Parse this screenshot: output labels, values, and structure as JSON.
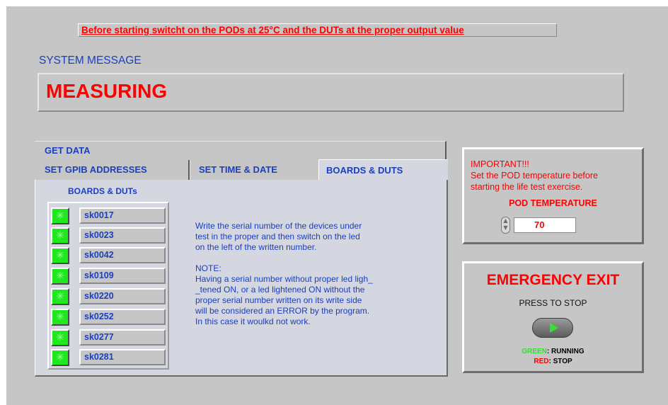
{
  "warning_banner": "Before starting switcht on the PODs at 25°C and the DUTs at the proper output value",
  "system_message": {
    "label": "SYSTEM MESSAGE",
    "value": "MEASURING"
  },
  "tabs": {
    "get_data": "GET DATA",
    "gpib": "SET GPIB ADDRESSES",
    "time": "SET TIME & DATE",
    "boards": "BOARDS & DUTS"
  },
  "boards": {
    "title": "BOARDS & DUTs",
    "rows": [
      {
        "serial": "sk0017",
        "led": "on"
      },
      {
        "serial": "sk0023",
        "led": "on"
      },
      {
        "serial": "sk0042",
        "led": "on"
      },
      {
        "serial": "sk0109",
        "led": "on"
      },
      {
        "serial": "sk0220",
        "led": "on"
      },
      {
        "serial": "sk0252",
        "led": "on"
      },
      {
        "serial": "sk0277",
        "led": "on"
      },
      {
        "serial": "sk0281",
        "led": "on"
      }
    ],
    "instructions": "Write the serial number of the devices under\ntest in the proper and then switch on the led\non the left of the written number.\n\nNOTE:\nHaving a serial number without proper led ligh_\n_tened ON, or a led lightened ON without the\nproper serial number written on its write side\nwill be considered an ERROR by the program.\nIn this case it woulkd not work."
  },
  "important": {
    "text": "IMPORTANT!!!\nSet the POD temperature before\nstarting the life test exercise.",
    "pod_label": "POD TEMPERATURE",
    "pod_value": "70"
  },
  "emergency": {
    "title": "EMERGENCY  EXIT",
    "subtitle": "PRESS TO STOP",
    "legend_green_word": "GREEN",
    "legend_green_label": ": RUNNING",
    "legend_red_word": "RED",
    "legend_red_label": ": STOP"
  },
  "colors": {
    "accent_blue": "#1a3fbf",
    "alert_red": "#ff0000",
    "led_green": "#1fe81f"
  }
}
